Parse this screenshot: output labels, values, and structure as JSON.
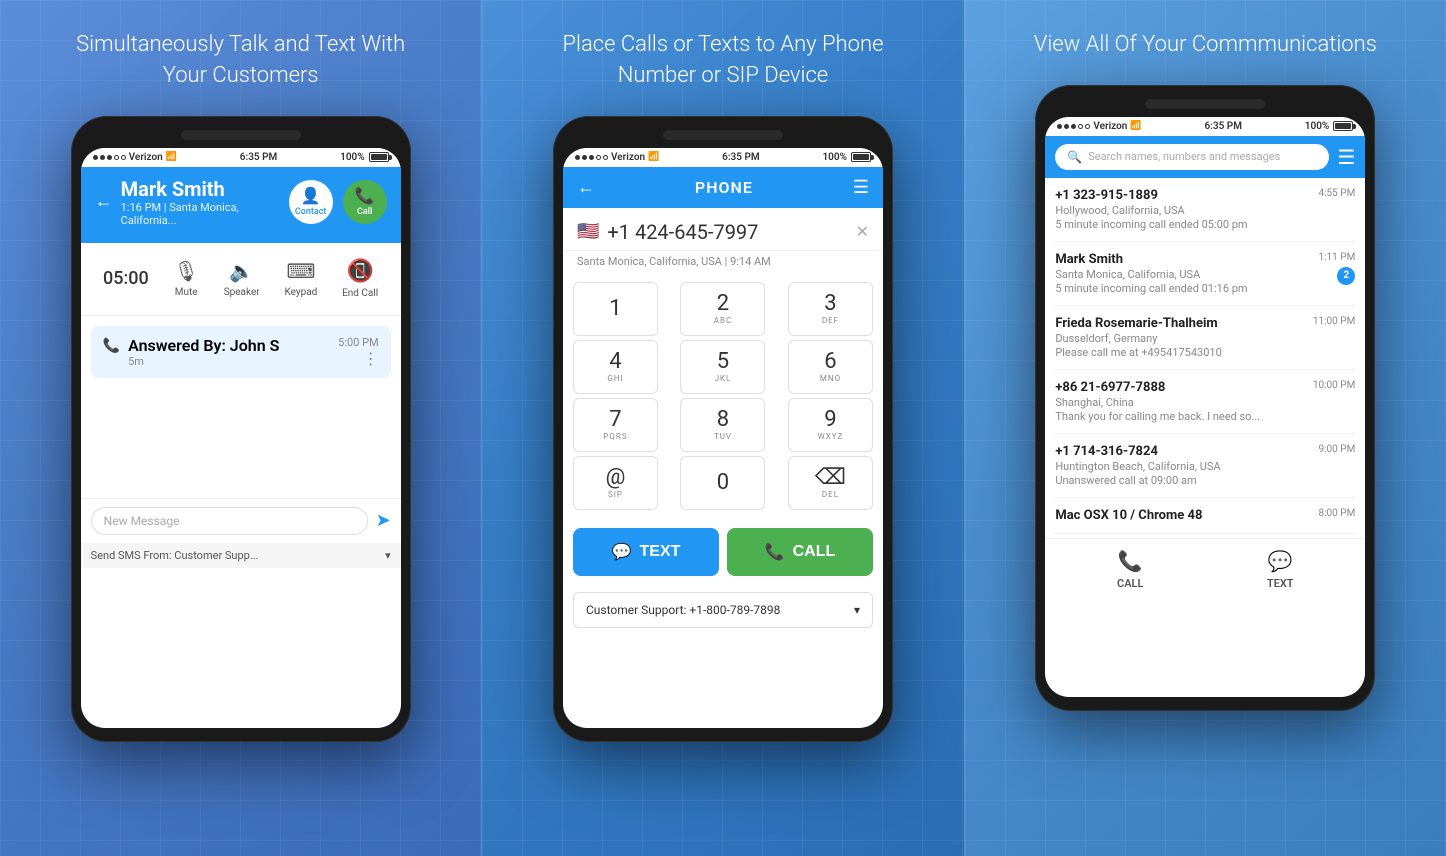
{
  "panels": [
    {
      "id": "left",
      "title": "Simultaneously Talk and Text With Your Customers",
      "phone": {
        "status": {
          "carrier": "Verizon",
          "wifi": true,
          "time": "6:35 PM",
          "battery": "100%"
        },
        "call_header": {
          "name": "Mark Smith",
          "subtitle": "1:16 PM | Santa Monica, California...",
          "contact_label": "Contact",
          "call_label": "Call"
        },
        "call_controls": {
          "timer": "05:00",
          "mute": "Mute",
          "speaker": "Speaker",
          "keypad": "Keypad",
          "end_call": "End Call"
        },
        "call_log": {
          "answered_by": "Answered By: John S",
          "duration": "5m",
          "time": "5:00 PM"
        },
        "message_placeholder": "New Message",
        "send_label": "Send",
        "sms_from": "Send SMS From: Customer Supp..."
      }
    },
    {
      "id": "mid",
      "title": "Place Calls or Texts to Any Phone Number or SIP Device",
      "phone": {
        "status": {
          "carrier": "Verizon",
          "wifi": true,
          "time": "6:35 PM",
          "battery": "100%"
        },
        "dialer_title": "PHONE",
        "phone_number": "+1 424-645-7997",
        "number_subtitle": "Santa Monica, California, USA | 9:14 AM",
        "keys": [
          [
            {
              "num": "1",
              "sub": ""
            },
            {
              "num": "2",
              "sub": "ABC"
            },
            {
              "num": "3",
              "sub": "DEF"
            }
          ],
          [
            {
              "num": "4",
              "sub": "GHI"
            },
            {
              "num": "5",
              "sub": "JKL"
            },
            {
              "num": "6",
              "sub": "MNO"
            }
          ],
          [
            {
              "num": "7",
              "sub": "PQRS"
            },
            {
              "num": "8",
              "sub": "TUV"
            },
            {
              "num": "9",
              "sub": "WXYZ"
            }
          ],
          [
            {
              "num": "@",
              "sub": "SIP"
            },
            {
              "num": "0",
              "sub": ""
            },
            {
              "num": "⌫",
              "sub": "DEL"
            }
          ]
        ],
        "text_btn": "TEXT",
        "call_btn": "CALL",
        "caller_id": "Customer Support: +1-800-789-7898"
      }
    },
    {
      "id": "right",
      "title": "View All Of Your Commmunications",
      "phone": {
        "status": {
          "carrier": "Verizon",
          "wifi": true,
          "time": "6:35 PM",
          "battery": "100%"
        },
        "search_placeholder": "Search names, numbers and messages",
        "contacts": [
          {
            "name": "+1 323-915-1889",
            "location": "Hollywood, California, USA",
            "detail": "5 minute incoming call ended 05:00 pm",
            "time": "4:55 PM",
            "unread": 0
          },
          {
            "name": "Mark Smith",
            "location": "Santa Monica, California, USA",
            "detail": "5 minute incoming call ended 01:16 pm",
            "time": "1:11 PM",
            "unread": 2
          },
          {
            "name": "Frieda Rosemarie-Thalheim",
            "location": "Dusseldorf, Germany",
            "detail": "Please call me at +495417543010",
            "time": "11:00 PM",
            "unread": 0
          },
          {
            "name": "+86 21-6977-7888",
            "location": "Shanghai, China",
            "detail": "Thank you for calling me back. I need so...",
            "time": "10:00 PM",
            "unread": 0
          },
          {
            "name": "+1 714-316-7824",
            "location": "Huntington Beach, California, USA",
            "detail": "Unanswered call at 09:00 am",
            "time": "9:00 PM",
            "unread": 0
          },
          {
            "name": "Mac OSX 10 / Chrome 48",
            "location": "",
            "detail": "",
            "time": "8:00 PM",
            "unread": 0
          }
        ],
        "footer": {
          "call_label": "CALL",
          "text_label": "TEXT"
        }
      }
    }
  ]
}
